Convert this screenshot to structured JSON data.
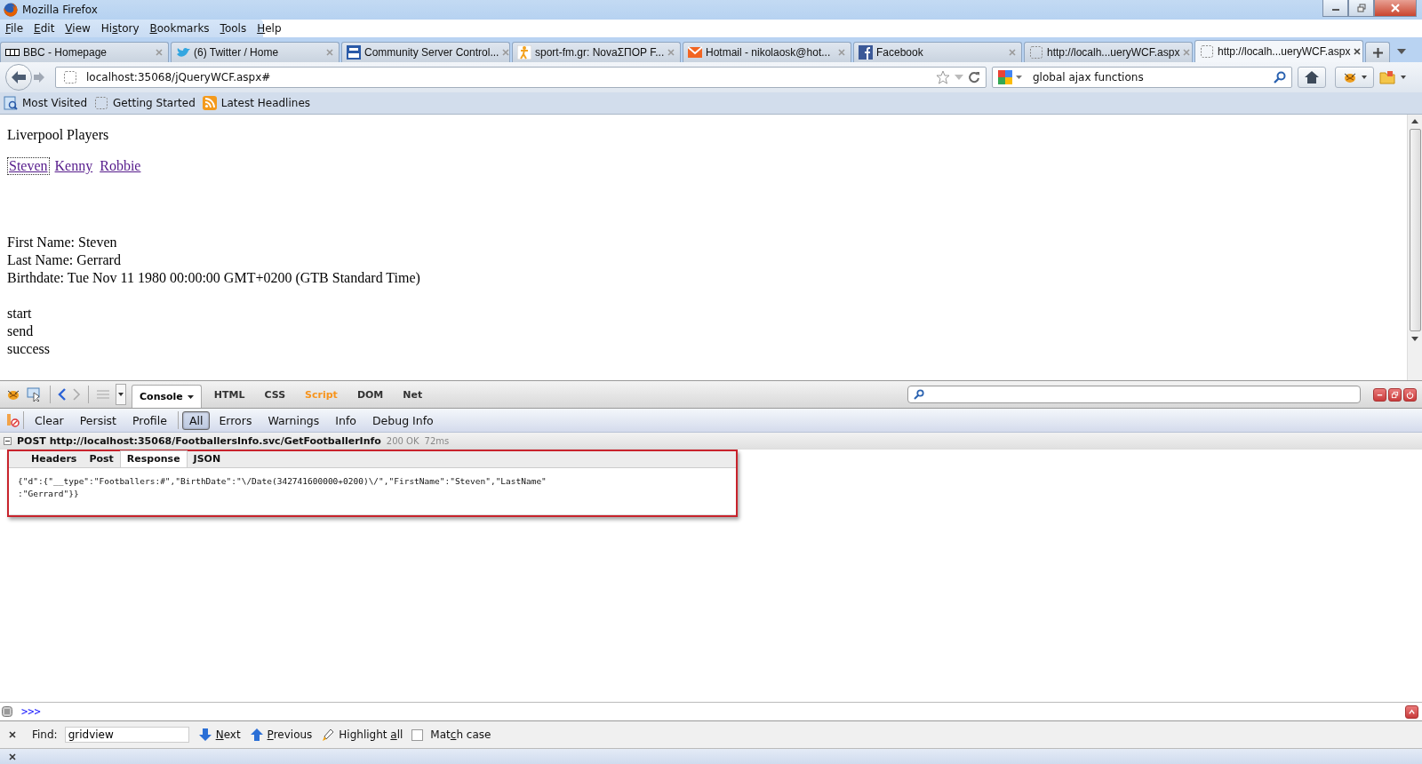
{
  "window": {
    "title": "Mozilla Firefox"
  },
  "menu": [
    {
      "key": "F",
      "after": "ile"
    },
    {
      "key": "E",
      "after": "dit"
    },
    {
      "key": "V",
      "after": "iew"
    },
    {
      "before": "Hi",
      "key": "s",
      "after": "tory"
    },
    {
      "key": "B",
      "after": "ookmarks"
    },
    {
      "key": "T",
      "after": "ools"
    },
    {
      "key": "H",
      "after": "elp"
    }
  ],
  "tabs": [
    {
      "title": "BBC - Homepage",
      "selected": false
    },
    {
      "title": "(6) Twitter / Home",
      "selected": false
    },
    {
      "title": "Community Server Control...",
      "selected": false
    },
    {
      "title": "sport-fm.gr: NovaΣΠΟΡ F...",
      "selected": false
    },
    {
      "title": "Hotmail - nikolaosk@hot...",
      "selected": false
    },
    {
      "title": "Facebook",
      "selected": false
    },
    {
      "title": "http://localh...ueryWCF.aspx",
      "selected": false
    },
    {
      "title": "http://localh...ueryWCF.aspx",
      "selected": true
    }
  ],
  "address": {
    "value": "localhost:35068/jQueryWCF.aspx#"
  },
  "search": {
    "value": "global ajax functions"
  },
  "bookmarks": [
    {
      "label": "Most Visited"
    },
    {
      "label": "Getting Started"
    },
    {
      "label": "Latest Headlines"
    }
  ],
  "page": {
    "heading": "Liverpool Players",
    "links": [
      {
        "label": "Steven",
        "focused": true
      },
      {
        "label": "Kenny",
        "focused": false
      },
      {
        "label": "Robbie",
        "focused": false
      }
    ],
    "details": [
      "First Name: Steven",
      "Last Name: Gerrard",
      "Birthdate: Tue Nov 11 1980 00:00:00 GMT+0200 (GTB Standard Time)"
    ],
    "events": [
      "start",
      "send",
      "success"
    ]
  },
  "firebug": {
    "panels": [
      {
        "label": "Console",
        "selected": true,
        "color": "#000000"
      },
      {
        "label": "HTML",
        "selected": false,
        "color": "#333333"
      },
      {
        "label": "CSS",
        "selected": false,
        "color": "#333333"
      },
      {
        "label": "Script",
        "selected": false,
        "color": "#f7941d"
      },
      {
        "label": "DOM",
        "selected": false,
        "color": "#333333"
      },
      {
        "label": "Net",
        "selected": false,
        "color": "#333333"
      }
    ],
    "actions": [
      "Clear",
      "Persist",
      "Profile"
    ],
    "filters": [
      {
        "label": "All",
        "selected": true
      },
      {
        "label": "Errors",
        "selected": false
      },
      {
        "label": "Warnings",
        "selected": false
      },
      {
        "label": "Info",
        "selected": false
      },
      {
        "label": "Debug Info",
        "selected": false
      }
    ],
    "request": {
      "method": "POST",
      "url": "http://localhost:35068/FootballersInfo.svc/GetFootballerInfo",
      "status": "200 OK",
      "time": "72ms",
      "expanded": true,
      "annotated": true,
      "tabs": [
        {
          "label": "Headers",
          "selected": false
        },
        {
          "label": "Post",
          "selected": false
        },
        {
          "label": "Response",
          "selected": true
        },
        {
          "label": "JSON",
          "selected": false
        }
      ],
      "body": "{\"d\":{\"__type\":\"Footballers:#\",\"BirthDate\":\"\\/Date(342741600000+0200)\\/\",\"FirstName\":\"Steven\",\"LastName\"\n:\"Gerrard\"}}"
    },
    "prompt": ">>>"
  },
  "find_bar": {
    "label": "Find:",
    "value": "gridview",
    "buttons": [
      {
        "key": "N",
        "after": "ext"
      },
      {
        "key": "P",
        "after": "revious"
      },
      {
        "before": "Highlight ",
        "key": "a",
        "after": "ll"
      }
    ],
    "match_case": {
      "before": "Mat",
      "key": "c",
      "after": "h case",
      "checked": false
    }
  }
}
